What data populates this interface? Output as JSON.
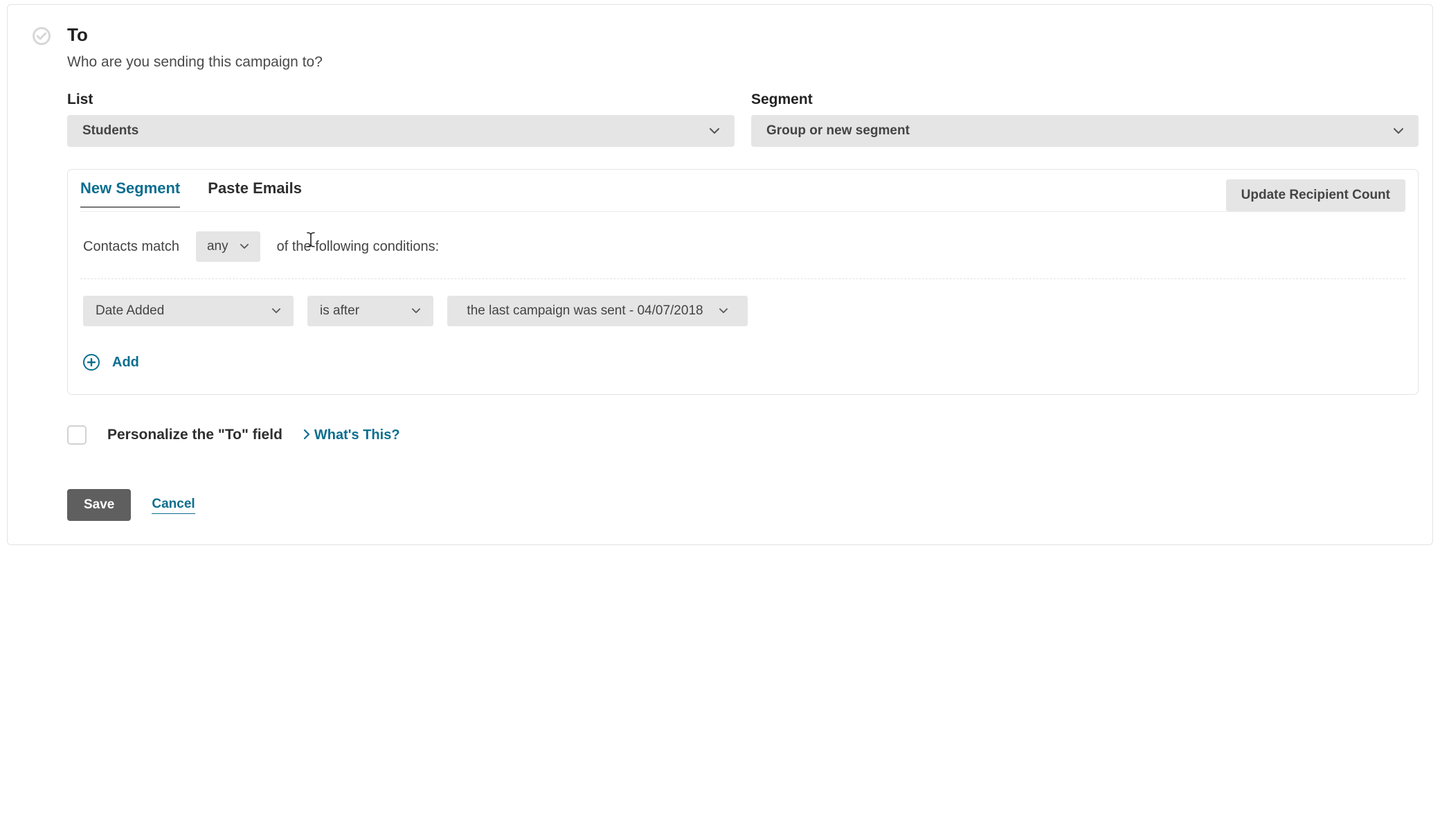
{
  "section": {
    "title": "To",
    "subtitle": "Who are you sending this campaign to?"
  },
  "list": {
    "label": "List",
    "value": "Students"
  },
  "segment": {
    "label": "Segment",
    "value": "Group or new segment"
  },
  "tabs": {
    "new_segment": "New Segment",
    "paste_emails": "Paste Emails"
  },
  "update_button": "Update Recipient Count",
  "match": {
    "prefix": "Contacts match",
    "mode": "any",
    "suffix": "of the following conditions:"
  },
  "condition": {
    "field": "Date Added",
    "operator": "is after",
    "value": "the last campaign was sent - 04/07/2018"
  },
  "add_label": "Add",
  "personalize": {
    "label": "Personalize the \"To\" field",
    "help": "What's This?"
  },
  "actions": {
    "save": "Save",
    "cancel": "Cancel"
  }
}
